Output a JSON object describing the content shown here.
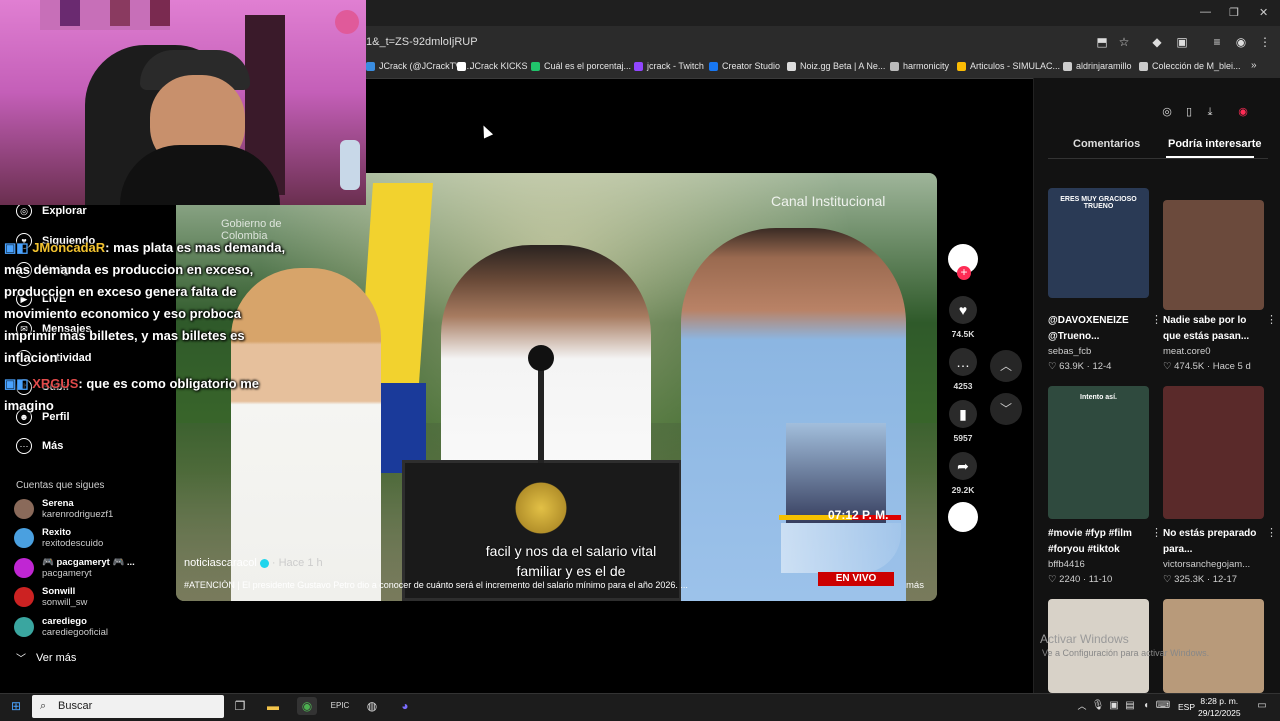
{
  "browser": {
    "url": "1&_t=ZS-92dmloIjRUP",
    "bookmarks": [
      {
        "label": "JCrack (@JCrackTV)...",
        "color": "#3a8de0"
      },
      {
        "label": "JCrack KICKS",
        "color": "#ffffff"
      },
      {
        "label": "Cuál es el porcentaj...",
        "color": "#21c46b"
      },
      {
        "label": "jcrack - Twitch",
        "color": "#9146ff"
      },
      {
        "label": "Creator Studio",
        "color": "#1877f2"
      },
      {
        "label": "Noiz.gg Beta | A Ne...",
        "color": "#dddddd"
      },
      {
        "label": "harmonicity",
        "color": "#bbbbbb"
      },
      {
        "label": "Articulos - SIMULAC...",
        "color": "#fbbc04"
      },
      {
        "label": "aldrinjaramillo",
        "color": "#cccccc"
      },
      {
        "label": "Colección de M_blei...",
        "color": "#cccccc"
      }
    ]
  },
  "sidebar": {
    "items": [
      {
        "label": "Explorar",
        "icon": "compass-icon"
      },
      {
        "label": "Siguiendo",
        "icon": "following-icon"
      },
      {
        "label": "Amigos",
        "icon": "friends-icon"
      },
      {
        "label": "LIVE",
        "icon": "live-icon"
      },
      {
        "label": "Mensajes",
        "icon": "messages-icon"
      },
      {
        "label": "Actividad",
        "icon": "activity-icon"
      },
      {
        "label": "Subir",
        "icon": "upload-icon"
      },
      {
        "label": "Perfil",
        "icon": "profile-icon"
      },
      {
        "label": "Más",
        "icon": "more-icon"
      }
    ],
    "following_title": "Cuentas que sigues",
    "following": [
      {
        "name": "Serena",
        "handle": "karenrodriguezf1",
        "color": "#8a6a5a"
      },
      {
        "name": "Rexito",
        "handle": "rexitodescuido",
        "color": "#4aa0e0"
      },
      {
        "name": "🎮 pacgameryt 🎮 ...",
        "handle": "pacgameryt",
        "color": "#c026d3"
      },
      {
        "name": "Sonwill",
        "handle": "sonwill_sw",
        "color": "#cc2222"
      },
      {
        "name": "carediego",
        "handle": "carediegooficial",
        "color": "#3aa6a0"
      }
    ],
    "see_more": "Ver más"
  },
  "chat": [
    {
      "user": "JMoncadaR",
      "text": ": mas plata es mas demanda, mas demanda es produccion en exceso, produccion en exceso genera falta de movimiento economico y eso proboca imprimir mas billetes, y mas billetes es inflacion"
    },
    {
      "user": "XRGUS",
      "text": ": que es como obligatorio me imagino"
    }
  ],
  "video": {
    "caption": "facil y nos da el salario vital familiar y es el de",
    "time_badge": "07:12 P. M.",
    "live_badge": "EN VIVO",
    "channel_tag": "Canal Institucional",
    "gov_tag": "Gobierno de Colombia",
    "author": "noticiascaracol",
    "posted": "· Hace 1 h",
    "description": "#ATENCIÓN | El presidente Gustavo Petro dio a conocer de cuánto será el incremento del salario mínimo para el año 2026. ...",
    "more": "más"
  },
  "actions": [
    {
      "icon": "heart-icon",
      "count": "74.5K"
    },
    {
      "icon": "comment-icon",
      "count": "4253"
    },
    {
      "icon": "bookmark-icon",
      "count": "5957"
    },
    {
      "icon": "share-icon",
      "count": "29.2K"
    }
  ],
  "right_panel": {
    "tabs": [
      "Comentarios",
      "Podría interesarte"
    ],
    "cards": [
      {
        "thumb": "ERES MUY GRACIOSO TRUENO",
        "title": "@DAVOXENEIZE @Trueno...",
        "author": "sebas_fcb",
        "likes": "63.9K",
        "date": "12-4",
        "bg": "#2a3a55"
      },
      {
        "thumb": "",
        "title": "Nadie sabe por lo que estás pasan...",
        "author": "meat.core0",
        "likes": "474.5K",
        "date": "Hace 5 d",
        "bg": "#6b4a3c"
      },
      {
        "thumb": "Intento así.",
        "title": "#movie #fyp #film #foryou #tiktok",
        "author": "bffb4416",
        "likes": "2240",
        "date": "11-10",
        "bg": "#2f4a3e"
      },
      {
        "thumb": "",
        "title": "No estás preparado para...",
        "author": "victorsanchegojam...",
        "likes": "325.3K",
        "date": "12-17",
        "bg": "#5a2a2a"
      },
      {
        "thumb": "",
        "title": "",
        "author": "",
        "likes": "",
        "date": "",
        "bg": "#d8d2c8"
      },
      {
        "thumb": "",
        "title": "",
        "author": "",
        "likes": "",
        "date": "",
        "bg": "#b89a7a"
      }
    ],
    "watermark": "Activar Windows",
    "watermark_sub": "Ve a Configuración para activar Windows."
  },
  "taskbar": {
    "search": "Buscar",
    "lang": "ESP",
    "time": "8:28 p. m.",
    "date": "29/12/2025"
  }
}
